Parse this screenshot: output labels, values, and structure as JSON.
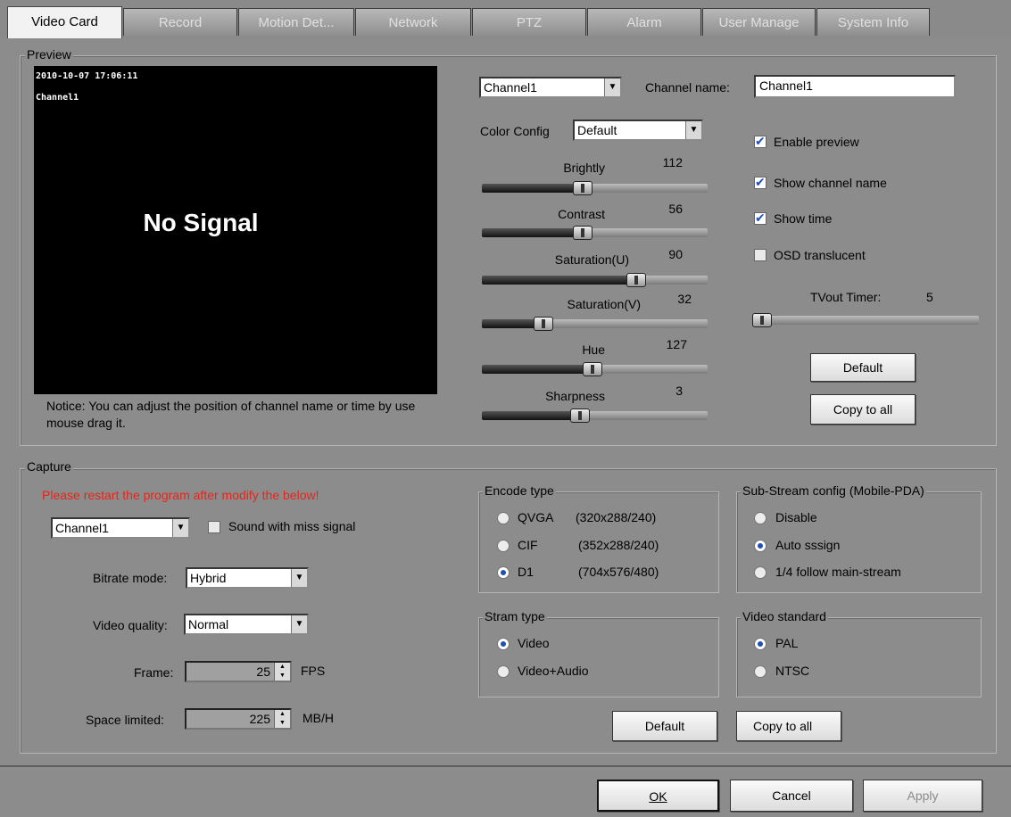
{
  "tabs": [
    "Video Card",
    "Record",
    "Motion Det...",
    "Network",
    "PTZ",
    "Alarm",
    "User Manage",
    "System Info"
  ],
  "preview": {
    "legend": "Preview",
    "osd_time": "2010-10-07 17:06:11",
    "osd_channel": "Channel1",
    "no_signal": "No Signal",
    "notice": "Notice: You can adjust the position of channel name or time by use mouse drag it.",
    "channel_select": "Channel1",
    "channel_name_label": "Channel name:",
    "channel_name_value": "Channel1",
    "color_config_label": "Color Config",
    "color_config_value": "Default",
    "sliders": [
      {
        "label": "Brightly",
        "value": "112",
        "level": 0.44
      },
      {
        "label": "Contrast",
        "value": "56",
        "level": 0.44
      },
      {
        "label": "Saturation(U)",
        "value": "90",
        "level": 0.7
      },
      {
        "label": "Saturation(V)",
        "value": "32",
        "level": 0.25
      },
      {
        "label": "Hue",
        "value": "127",
        "level": 0.49
      },
      {
        "label": "Sharpness",
        "value": "3",
        "level": 0.43
      }
    ],
    "enable_preview": "Enable preview",
    "show_channel_name": "Show channel name",
    "show_time": "Show time",
    "osd_translucent": "OSD translucent",
    "tvout_label": "TVout Timer:",
    "tvout_value": "5",
    "default_btn": "Default",
    "copy_btn": "Copy to all"
  },
  "capture": {
    "legend": "Capture",
    "warning": "Please restart the program after modify the below!",
    "channel_select": "Channel1",
    "sound_miss": "Sound with miss signal",
    "bitrate_label": "Bitrate mode:",
    "bitrate_value": "Hybrid",
    "quality_label": "Video quality:",
    "quality_value": "Normal",
    "frame_label": "Frame:",
    "frame_value": "25",
    "frame_unit": "FPS",
    "space_label": "Space limited:",
    "space_value": "225",
    "space_unit": "MB/H",
    "encode_legend": "Encode type",
    "enc_qvga": "QVGA",
    "enc_qvga_res": "(320x288/240)",
    "enc_cif": "CIF",
    "enc_cif_res": "(352x288/240)",
    "enc_d1": "D1",
    "enc_d1_res": "(704x576/480)",
    "sub_legend": "Sub-Stream config (Mobile-PDA)",
    "sub_disable": "Disable",
    "sub_auto": "Auto sssign",
    "sub_quarter": "1/4 follow main-stream",
    "stream_legend": "Stram type",
    "stream_video": "Video",
    "stream_va": "Video+Audio",
    "std_legend": "Video standard",
    "std_pal": "PAL",
    "std_ntsc": "NTSC",
    "default_btn": "Default",
    "copy_btn": "Copy to all"
  },
  "footer": {
    "ok": "OK",
    "cancel": "Cancel",
    "apply": "Apply"
  }
}
